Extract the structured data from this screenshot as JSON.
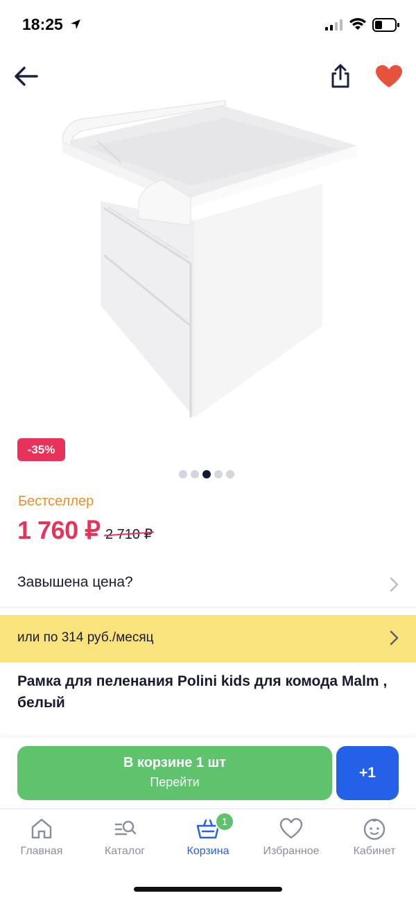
{
  "status": {
    "time": "18:25"
  },
  "product": {
    "discount": "-35%",
    "badge": "Бестселлер",
    "price": "1 760 ₽",
    "old_price": "2 710 ₽",
    "title": "Рамка для пеленания Polini kids для комода Malm , белый",
    "gallery": {
      "total": 5,
      "active_index": 2
    }
  },
  "rows": {
    "price_question": "Завышена цена?",
    "installment": "или по 314 руб./месяц"
  },
  "cart": {
    "in_cart_label": "В корзине 1 шт",
    "go_label": "Перейти",
    "plus_label": "+1"
  },
  "tabs": [
    {
      "label": "Главная",
      "icon": "home-icon"
    },
    {
      "label": "Каталог",
      "icon": "catalog-search-icon"
    },
    {
      "label": "Корзина",
      "icon": "basket-icon",
      "active": true,
      "badge": "1"
    },
    {
      "label": "Избранное",
      "icon": "heart-icon"
    },
    {
      "label": "Кабинет",
      "icon": "profile-face-icon"
    }
  ],
  "colors": {
    "accent_red": "#e8325a",
    "accent_blue": "#2561e8",
    "green": "#5fc26d",
    "yellow": "#f8e37d",
    "bestseller_orange": "#f08c2a"
  }
}
